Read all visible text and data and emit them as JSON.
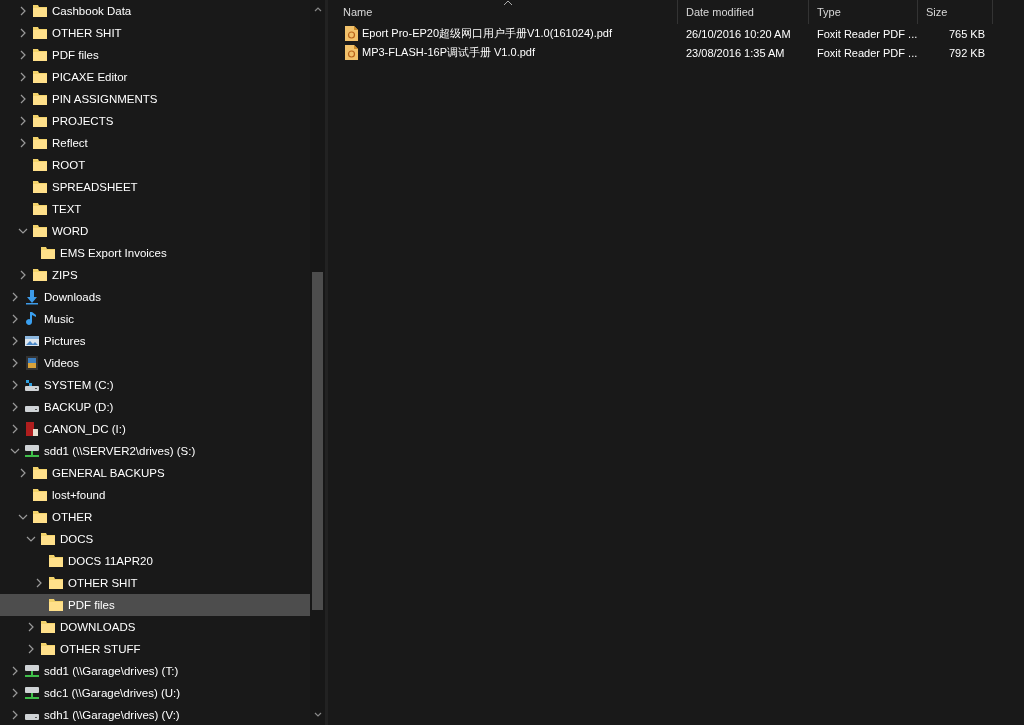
{
  "nav_tree": {
    "continued_items": [
      {
        "label": "Cashbook Data",
        "kind": "folder",
        "expanded": false,
        "selected": false
      },
      {
        "label": "OTHER SHIT",
        "kind": "folder",
        "expanded": false,
        "selected": false
      },
      {
        "label": "PDF files",
        "kind": "folder",
        "expanded": false,
        "selected": false
      },
      {
        "label": "PICAXE Editor",
        "kind": "folder",
        "expanded": false,
        "selected": false
      },
      {
        "label": "PIN ASSIGNMENTS",
        "kind": "folder",
        "expanded": false,
        "selected": false
      },
      {
        "label": "PROJECTS",
        "kind": "folder",
        "expanded": false,
        "selected": false
      },
      {
        "label": "Reflect",
        "kind": "folder",
        "expanded": false,
        "selected": false
      },
      {
        "label": "ROOT",
        "kind": "folder",
        "selected": false
      },
      {
        "label": "SPREADSHEET",
        "kind": "folder",
        "selected": false
      },
      {
        "label": "TEXT",
        "kind": "folder",
        "selected": false
      },
      {
        "label": "WORD",
        "kind": "folder",
        "expanded": true,
        "selected": false,
        "children": [
          {
            "label": "EMS Export Invoices",
            "kind": "folder",
            "selected": false
          }
        ]
      },
      {
        "label": "ZIPS",
        "kind": "folder",
        "expanded": false,
        "selected": false
      }
    ],
    "items": [
      {
        "label": "Downloads",
        "kind": "downloads",
        "expanded": false,
        "selected": false
      },
      {
        "label": "Music",
        "kind": "music",
        "expanded": false,
        "selected": false
      },
      {
        "label": "Pictures",
        "kind": "pictures",
        "expanded": false,
        "selected": false
      },
      {
        "label": "Videos",
        "kind": "videos",
        "expanded": false,
        "selected": false
      },
      {
        "label": "SYSTEM (C:)",
        "kind": "system-drive",
        "expanded": false,
        "selected": false
      },
      {
        "label": "BACKUP (D:)",
        "kind": "drive",
        "expanded": false,
        "selected": false
      },
      {
        "label": "CANON_DC (I:)",
        "kind": "camera-card",
        "expanded": false,
        "selected": false
      },
      {
        "label": "sdd1 (\\\\SERVER2\\drives) (S:)",
        "kind": "network-drive",
        "expanded": true,
        "selected": false,
        "children": [
          {
            "label": "GENERAL BACKUPS",
            "kind": "folder",
            "expanded": false,
            "selected": false
          },
          {
            "label": "lost+found",
            "kind": "folder",
            "selected": false
          },
          {
            "label": "OTHER",
            "kind": "folder",
            "expanded": true,
            "selected": false,
            "children": [
              {
                "label": "DOCS",
                "kind": "folder",
                "expanded": true,
                "selected": false,
                "children": [
                  {
                    "label": "DOCS 11APR20",
                    "kind": "folder",
                    "selected": false
                  },
                  {
                    "label": "OTHER SHIT",
                    "kind": "folder",
                    "expanded": false,
                    "selected": false
                  },
                  {
                    "label": "PDF files",
                    "kind": "folder",
                    "selected": true
                  }
                ]
              },
              {
                "label": "DOWNLOADS",
                "kind": "folder",
                "expanded": false,
                "selected": false
              },
              {
                "label": "OTHER STUFF",
                "kind": "folder",
                "expanded": false,
                "selected": false
              }
            ]
          }
        ]
      },
      {
        "label": "sdd1 (\\\\Garage\\drives) (T:)",
        "kind": "network-drive",
        "expanded": false,
        "selected": false
      },
      {
        "label": "sdc1 (\\\\Garage\\drives) (U:)",
        "kind": "network-drive",
        "expanded": false,
        "selected": false
      },
      {
        "label": "sdh1 (\\\\Garage\\drives) (V:)",
        "kind": "drive",
        "expanded": false,
        "selected": false
      }
    ]
  },
  "file_list": {
    "columns": [
      "Name",
      "Date modified",
      "Type",
      "Size"
    ],
    "rows": [
      {
        "name": "Eport Pro-EP20超级网口用户手册V1.0(161024).pdf",
        "date_modified": "26/10/2016 10:20 AM",
        "type": "Foxit Reader PDF ...",
        "size": "765 KB"
      },
      {
        "name": "MP3-FLASH-16P调试手册 V1.0.pdf",
        "date_modified": "23/08/2016 1:35 AM",
        "type": "Foxit Reader PDF ...",
        "size": "792 KB"
      }
    ]
  }
}
